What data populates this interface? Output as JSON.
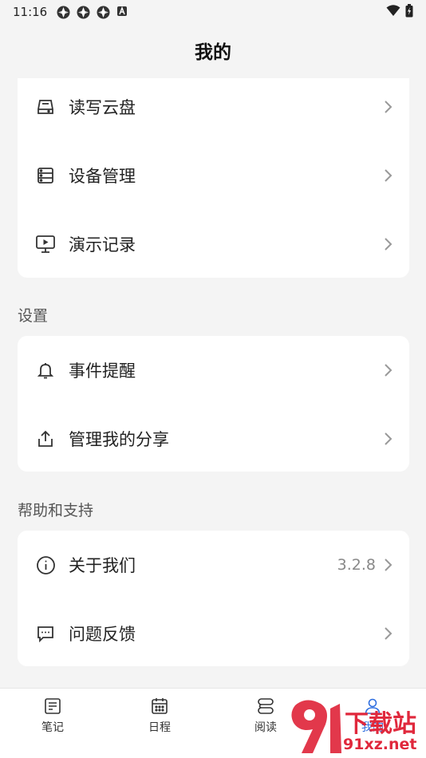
{
  "status": {
    "time": "11:16"
  },
  "header": {
    "title": "我的"
  },
  "group1": {
    "items": [
      {
        "label": "读写云盘"
      },
      {
        "label": "设备管理"
      },
      {
        "label": "演示记录"
      }
    ]
  },
  "settings": {
    "section": "设置",
    "items": [
      {
        "label": "事件提醒"
      },
      {
        "label": "管理我的分享"
      }
    ]
  },
  "help": {
    "section": "帮助和支持",
    "items": [
      {
        "label": "关于我们",
        "value": "3.2.8"
      },
      {
        "label": "问题反馈"
      }
    ]
  },
  "tabs": [
    {
      "label": "笔记"
    },
    {
      "label": "日程"
    },
    {
      "label": "阅读"
    },
    {
      "label": "我的",
      "active": true
    }
  ],
  "watermark": {
    "logo": "下载站",
    "url": "91xz.net"
  },
  "colors": {
    "accent": "#2f6fe0",
    "background": "#f4f4f4",
    "card": "#ffffff",
    "watermark": "#e0283c"
  }
}
